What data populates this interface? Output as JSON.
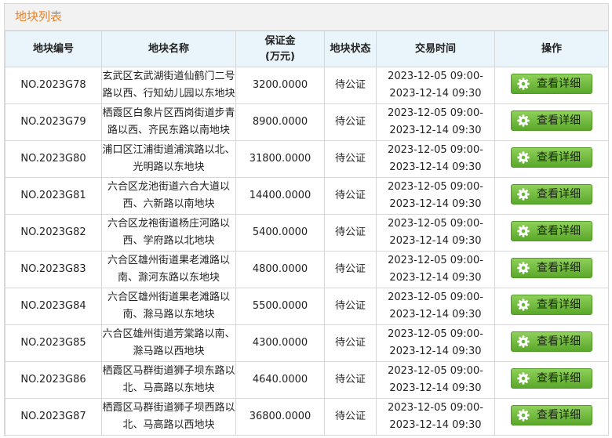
{
  "panel": {
    "title": "地块列表"
  },
  "table": {
    "headers": {
      "code": "地块编号",
      "name": "地块名称",
      "deposit_line1": "保证金",
      "deposit_line2": "(万元)",
      "status": "地块状态",
      "time": "交易时间",
      "action": "操作"
    },
    "action_label": "查看详细",
    "action_icon": "gear-icon",
    "rows": [
      {
        "code": "NO.2023G78",
        "name": "玄武区玄武湖街道仙鹤门二号路以西、行知幼儿园以东地块",
        "deposit": "3200.0000",
        "status": "待公证",
        "time_start": "2023-12-05 09:00-",
        "time_end": "2023-12-14 09:30"
      },
      {
        "code": "NO.2023G79",
        "name": "栖霞区白象片区西岗街道步青路以西、齐民东路以南地块",
        "deposit": "8900.0000",
        "status": "待公证",
        "time_start": "2023-12-05 09:00-",
        "time_end": "2023-12-14 09:30"
      },
      {
        "code": "NO.2023G80",
        "name": "浦口区江浦街道浦滨路以北、光明路以东地块",
        "deposit": "31800.0000",
        "status": "待公证",
        "time_start": "2023-12-05 09:00-",
        "time_end": "2023-12-14 09:30"
      },
      {
        "code": "NO.2023G81",
        "name": "六合区龙池街道六合大道以西、六新路以南地块",
        "deposit": "14400.0000",
        "status": "待公证",
        "time_start": "2023-12-05 09:00-",
        "time_end": "2023-12-14 09:30"
      },
      {
        "code": "NO.2023G82",
        "name": "六合区龙袍街道杨庄河路以西、学府路以北地块",
        "deposit": "5400.0000",
        "status": "待公证",
        "time_start": "2023-12-05 09:00-",
        "time_end": "2023-12-14 09:30"
      },
      {
        "code": "NO.2023G83",
        "name": "六合区雄州街道果老滩路以南、滁河东路以东地块",
        "deposit": "4800.0000",
        "status": "待公证",
        "time_start": "2023-12-05 09:00-",
        "time_end": "2023-12-14 09:30"
      },
      {
        "code": "NO.2023G84",
        "name": "六合区雄州街道果老滩路以南、滁马路以东地块",
        "deposit": "5500.0000",
        "status": "待公证",
        "time_start": "2023-12-05 09:00-",
        "time_end": "2023-12-14 09:30"
      },
      {
        "code": "NO.2023G85",
        "name": "六合区雄州街道芳棠路以南、滁马路以西地块",
        "deposit": "4300.0000",
        "status": "待公证",
        "time_start": "2023-12-05 09:00-",
        "time_end": "2023-12-14 09:30"
      },
      {
        "code": "NO.2023G86",
        "name": "栖霞区马群街道狮子坝东路以北、马高路以东地块",
        "deposit": "4640.0000",
        "status": "待公证",
        "time_start": "2023-12-05 09:00-",
        "time_end": "2023-12-14 09:30"
      },
      {
        "code": "NO.2023G87",
        "name": "栖霞区马群街道狮子坝西路以北、马高路以西地块",
        "deposit": "36800.0000",
        "status": "待公证",
        "time_start": "2023-12-05 09:00-",
        "time_end": "2023-12-14 09:30"
      }
    ]
  }
}
